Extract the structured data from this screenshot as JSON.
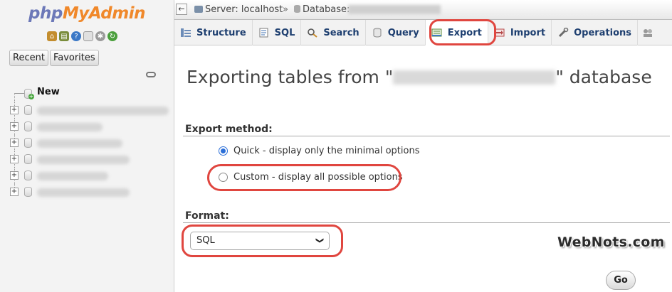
{
  "sidebar": {
    "logo": {
      "php": "php",
      "myadmin": "MyAdmin"
    },
    "quick_icons": [
      "home-icon",
      "database-icon",
      "help-icon",
      "docs-icon",
      "gear-icon",
      "reload-icon"
    ],
    "recent_label": "Recent",
    "favorites_label": "Favorites",
    "tree_new_label": "New"
  },
  "breadcrumb": {
    "server": "Server: localhost",
    "separator": "»",
    "database": "Database:"
  },
  "tabs": [
    {
      "label": "Structure",
      "icon": "structure-icon"
    },
    {
      "label": "SQL",
      "icon": "sql-icon"
    },
    {
      "label": "Search",
      "icon": "search-icon"
    },
    {
      "label": "Query",
      "icon": "query-icon"
    },
    {
      "label": "Export",
      "icon": "export-icon",
      "active": true
    },
    {
      "label": "Import",
      "icon": "import-icon"
    },
    {
      "label": "Operations",
      "icon": "operations-icon"
    }
  ],
  "main": {
    "title_prefix": "Exporting tables from \"",
    "title_suffix": "\" database",
    "export_method_heading": "Export method:",
    "quick_option": "Quick - display only the minimal options",
    "custom_option": "Custom - display all possible options",
    "format_heading": "Format:",
    "format_value": "SQL",
    "go_label": "Go"
  },
  "watermark": "WebNots.com",
  "colors": {
    "highlight": "#e0463f",
    "tab_text": "#1e3f70",
    "radio_accent": "#2a6ed8"
  }
}
